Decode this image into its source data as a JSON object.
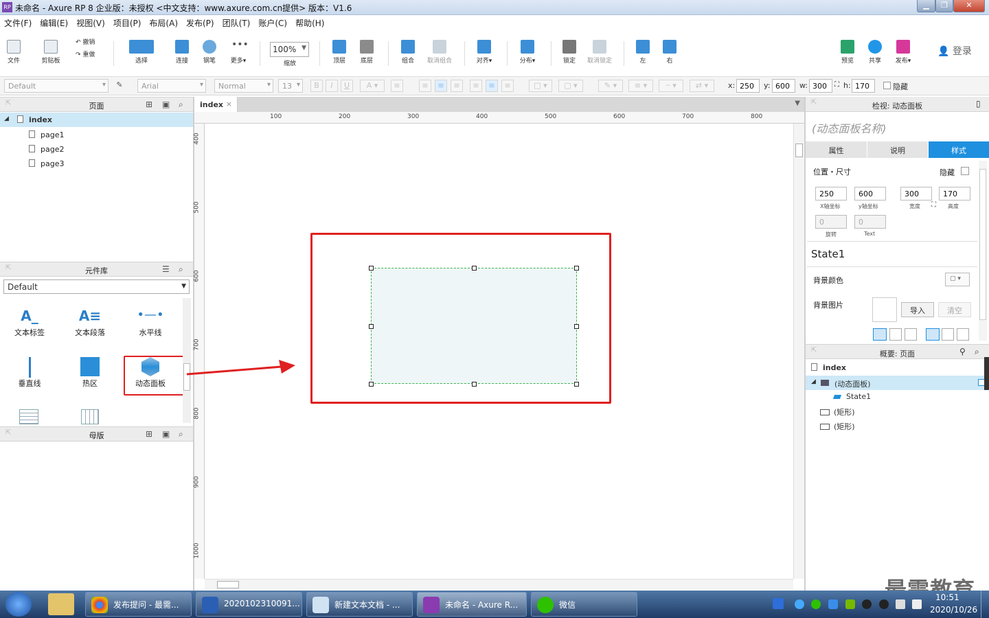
{
  "window": {
    "title": "未命名 - Axure RP 8 企业版：未授权      <中文支持：www.axure.com.cn提供> 版本：V1.6",
    "app_icon": "RP"
  },
  "menu": [
    "文件(F)",
    "编辑(E)",
    "视图(V)",
    "项目(P)",
    "布局(A)",
    "发布(P)",
    "团队(T)",
    "账户(C)",
    "帮助(H)"
  ],
  "toolbar": {
    "file": "文件",
    "clipboard": "剪贴板",
    "undo": "撤销",
    "redo": "重做",
    "select": "选择",
    "connect": "连接",
    "pen": "钢笔",
    "more": "更多▾",
    "zoom": "100%",
    "zoom_label": "缩放",
    "top": "顶层",
    "bottom": "底层",
    "group": "组合",
    "ungroup": "取消组合",
    "align": "对齐▾",
    "distribute": "分布▾",
    "lock": "锁定",
    "unlock": "取消锁定",
    "left": "左",
    "right": "右",
    "preview": "预览",
    "share": "共享",
    "publish": "发布▾",
    "login": "登录"
  },
  "format": {
    "style": "Default",
    "font": "Arial",
    "weight": "Normal",
    "size": "13",
    "x_label": "x:",
    "x": "250",
    "y_label": "y:",
    "y": "600",
    "w_label": "w:",
    "w": "300",
    "h_label": "h:",
    "h": "170",
    "hidden_label": "隐藏"
  },
  "pages_panel": {
    "title": "页面",
    "items": [
      "index",
      "page1",
      "page2",
      "page3"
    ]
  },
  "library_panel": {
    "title": "元件库",
    "selected": "Default",
    "widgets": [
      "文本标签",
      "文本段落",
      "水平线",
      "垂直线",
      "热区",
      "动态面板"
    ]
  },
  "masters_panel": {
    "title": "母版"
  },
  "canvas": {
    "tab": "index",
    "ruler_h": [
      "100",
      "200",
      "300",
      "400",
      "500",
      "600",
      "700",
      "800"
    ],
    "ruler_v": [
      "400",
      "500",
      "600",
      "700",
      "800",
      "900",
      "1000"
    ]
  },
  "inspector": {
    "header": "检视: 动态面板",
    "name_placeholder": "(动态面板名称)",
    "tabs": [
      "属性",
      "说明",
      "样式"
    ],
    "pos_size": "位置・尺寸",
    "hidden": "隐藏",
    "x": "250",
    "y": "600",
    "w": "300",
    "h": "170",
    "x_cap": "X轴坐标",
    "y_cap": "y轴坐标",
    "w_cap": "宽度",
    "h_cap": "高度",
    "rot": "0",
    "rot_cap": "旋转",
    "text_rot": "0",
    "text_cap": "Text",
    "state": "State1",
    "bg_color": "背景颜色",
    "bg_image": "背景图片",
    "import": "导入",
    "clear": "清空"
  },
  "outline": {
    "header": "概要: 页面",
    "items": [
      "index",
      "(动态面板)",
      "State1",
      "(矩形)",
      "(矩形)"
    ]
  },
  "taskbar": {
    "items": [
      "发布提问 - 最需...",
      "2020102310091...",
      "新建文本文档 - ...",
      "未命名 - Axure R...",
      "微信"
    ],
    "time": "10:51",
    "date": "2020/10/26",
    "watermark": "最需教育"
  },
  "colors": {
    "accent": "#2f8fd8",
    "highlight_red": "#e02020",
    "selection_green": "#3cb34a"
  }
}
